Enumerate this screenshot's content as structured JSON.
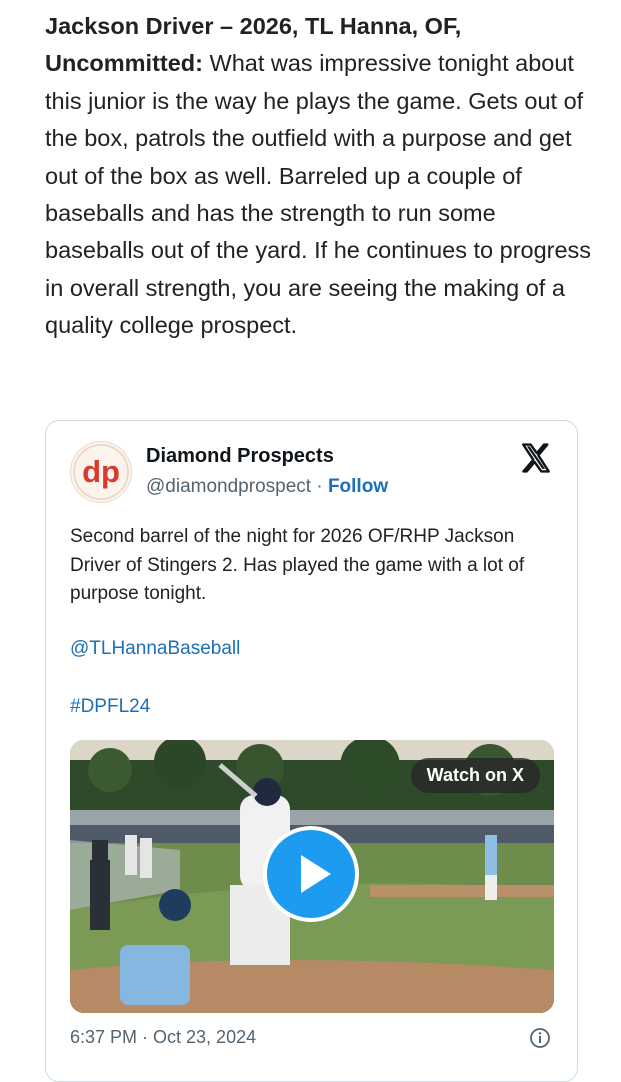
{
  "article": {
    "lead": "Jackson Driver – 2026, TL Hanna, OF, Uncommitted:",
    "body": "What was impressive tonight about this junior is the way he plays the game. Gets out of the box, patrols the outfield with a purpose and get out of the box as well. Barreled up a couple of baseballs and has the strength to run some baseballs out of the yard. If he continues to progress in overall strength, you are seeing the making of a quality college prospect."
  },
  "embed": {
    "author_name": "Diamond Prospects",
    "avatar_text": "dp",
    "handle": "@diamondprospect",
    "separator": "·",
    "follow_label": "Follow",
    "tweet_text": "Second barrel of the night for 2026 OF/RHP Jackson Driver of Stingers 2. Has played the game with a lot of purpose tonight.",
    "mention": "@TLHannaBaseball",
    "hashtag": "#DPFL24",
    "watch_label": "Watch on X",
    "timestamp": "6:37 PM · Oct 23, 2024",
    "icons": {
      "x_logo": "x-logo-icon",
      "play": "play-icon",
      "info": "info-icon"
    },
    "colors": {
      "link": "#1d6fb8",
      "play_button": "#1d9bf0",
      "avatar_red": "#d93a2b"
    }
  }
}
